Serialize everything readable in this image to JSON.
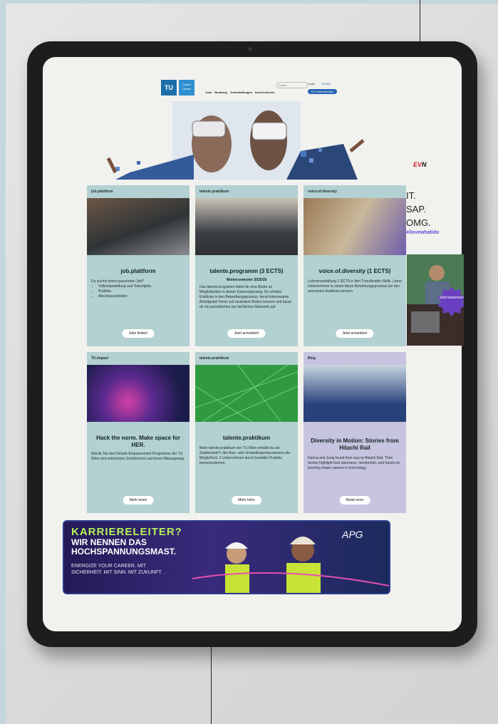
{
  "header": {
    "logo_tu": "TU",
    "logo_center": "Career Center",
    "search_placeholder": "Suche...",
    "login": "Login",
    "lang": "EN/DE",
    "nav": [
      "Jobs",
      "Beratung",
      "Veranstaltungen",
      "karrieremesse"
    ],
    "cta": "Für Unternehmen"
  },
  "cards": [
    {
      "tag": "job.plattform",
      "title": "job.plattform",
      "subtitle": "",
      "body": "Du suchst einen passenden Job?",
      "bullets": [
        "Vollzeitanstellung und Teilzeitjobs",
        "Praktika",
        "Abschlussarbeiten"
      ],
      "button": "Jobs finden!"
    },
    {
      "tag": "talente.praktikum",
      "title": "talente.programm (3 ECTS)",
      "subtitle": "Wintersemester 2025/26",
      "body": "Das talente.programm bietet dir eine Breite an Möglichkeiten in deiner Karriereplanung. Du erhältst Einblicke in den Bewerbungsprozess, lernst interessante Arbeitgeber*innen auf neutralem Boden kennen und baust dir ein persönliches wie fachliches Netzwerk auf.",
      "bullets": [],
      "button": "Jetzt anmelden!"
    },
    {
      "tag": "voice.of.diversity",
      "title": "voice.of.diversity (1 ECTS)",
      "subtitle": "",
      "body": "Lehrveranstaltung 1 ECTS in den Transferable Skills. Lerne Unternehmen in einem fairen Bewerbungsprozess bei den anonymen Auditions kennen.",
      "bullets": [],
      "button": "Jetzt anmelden!"
    },
    {
      "tag": "TU.impact",
      "title": "Hack the norm. Make space for HER.",
      "subtitle": "",
      "body": "Werde Teil des Female Empowerment Programms der TU Wien und unterstütze Schülerinnen auf ihrem Bildungsweg.",
      "bullets": [],
      "button": "Mehr lesen"
    },
    {
      "tag": "talente.praktikum",
      "title": "talente.praktikum",
      "subtitle": "",
      "body": "Beim talente.praktikum der TU Wien erhältst du als Studierende*r des Bau- oder Umweltingenieurwesens die Möglichkeit, 2 Unternehmen durch bezahlte Praktika kennenzulernen.",
      "bullets": [],
      "button": "Mehr Infos"
    },
    {
      "tag": "Blog",
      "title": "Diversity in Motion: Stories from Hitachi Rail",
      "subtitle": "",
      "body": "Darina and Josip found their way to Hitachi Rail. Their stories highlight how openness, mentorship, and hands-on learning shape careers in technology.",
      "bullets": [],
      "button": "Read more"
    }
  ],
  "banner": {
    "line1": "KARRIERELEITER?",
    "line2": "WIR NENNEN DAS HOCHSPANNUNGSMAST.",
    "line3": "ENERGIZE YOUR CAREER. MIT SICHERHEIT. MIT SINN. MIT ZUKUNFT.",
    "brand": "APG"
  },
  "side_ad": {
    "brand_prefix": "EV",
    "brand_suffix": "N",
    "slogan": [
      "IT.",
      "SAP.",
      "OMG."
    ],
    "hashtag": "#ilovewhatido",
    "badge": "Jetzt bewerben!"
  },
  "colors": {
    "card_teal": "#b3d0d2",
    "card_purple": "#c6c4de",
    "accent_blue": "#2463b0",
    "banner_green": "#b6f05a",
    "hashtag_purple": "#6a4ad6"
  }
}
